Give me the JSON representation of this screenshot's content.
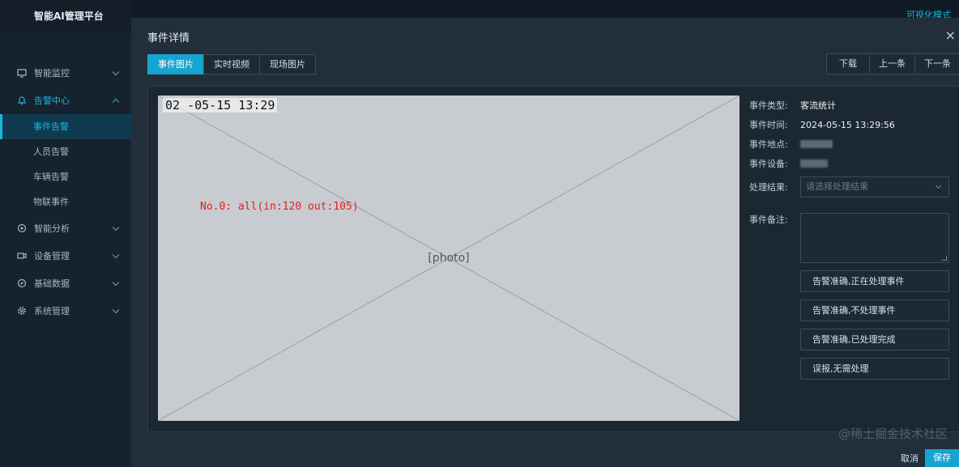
{
  "app": {
    "title": "智能AI管理平台",
    "topbar_right": "可视化模式"
  },
  "sidebar": {
    "items": [
      {
        "label": "智能监控",
        "icon": "monitor-icon"
      },
      {
        "label": "告警中心",
        "icon": "bell-icon",
        "open": true,
        "children": [
          {
            "label": "事件告警",
            "active": true
          },
          {
            "label": "人员告警"
          },
          {
            "label": "车辆告警"
          },
          {
            "label": "物联事件"
          }
        ]
      },
      {
        "label": "智能分析",
        "icon": "analysis-icon"
      },
      {
        "label": "设备管理",
        "icon": "camera-icon"
      },
      {
        "label": "基础数据",
        "icon": "compass-icon"
      },
      {
        "label": "系统管理",
        "icon": "gear-icon"
      }
    ]
  },
  "modal": {
    "title": "事件详情",
    "close": "×",
    "tabs": [
      "事件图片",
      "实时视频",
      "现场图片"
    ],
    "nav": {
      "download": "下载",
      "prev": "上一条",
      "next": "下一条"
    },
    "scene": {
      "timestamp": "02 -05-15 13:29",
      "counter": "No.0: all(in:120 out:105)"
    },
    "info": {
      "type_label": "事件类型:",
      "type_value": "客流统计",
      "time_label": "事件时间:",
      "time_value": "2024-05-15 13:29:56",
      "location_label": "事件地点:",
      "device_label": "事件设备:",
      "result_label": "处理结果:",
      "result_placeholder": "请选择处理结果",
      "remark_label": "事件备注:"
    },
    "actions": [
      "告警准确,正在处理事件",
      "告警准确,不处理事件",
      "告警准确,已处理完成",
      "误报,无需处理"
    ],
    "footer": {
      "cancel": "取消",
      "save": "保存"
    }
  },
  "watermark": "@稀土掘金技术社区"
}
